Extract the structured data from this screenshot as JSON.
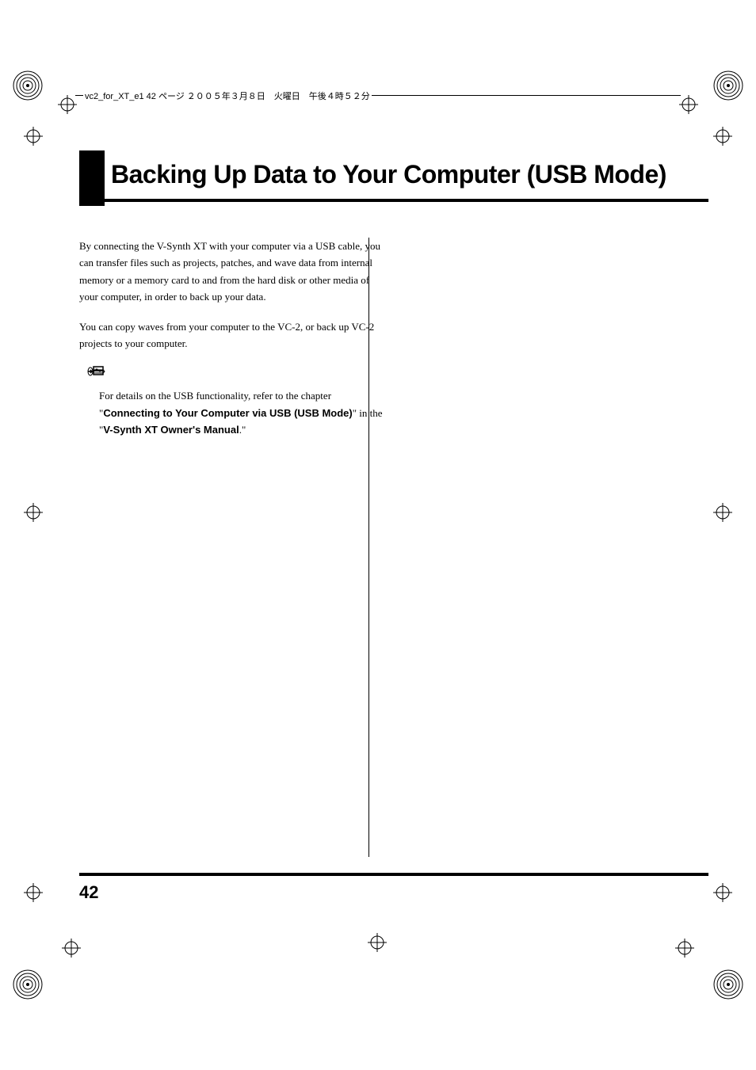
{
  "header": {
    "file_info": "vc2_for_XT_e1  42 ページ  ２００５年３月８日　火曜日　午後４時５２分"
  },
  "chapter": {
    "title": "Backing Up Data to Your Computer (USB Mode)"
  },
  "body": {
    "para1": "By connecting the V-Synth XT with your computer via a USB cable, you can transfer files such as projects, patches, and wave data from internal memory or a memory card to and from the hard disk or other media of your computer, in order to back up your data.",
    "para2": "You can copy waves from your computer to the VC-2, or back up VC-2 projects to your computer.",
    "ref_intro": "For details on the USB functionality, refer to the chapter \"",
    "ref_bold1": "Connecting to Your Computer via USB (USB Mode)",
    "ref_mid": "\" in the \"",
    "ref_bold2": "V-Synth XT Owner's Manual",
    "ref_end": ".\""
  },
  "footer": {
    "page_number": "42"
  }
}
